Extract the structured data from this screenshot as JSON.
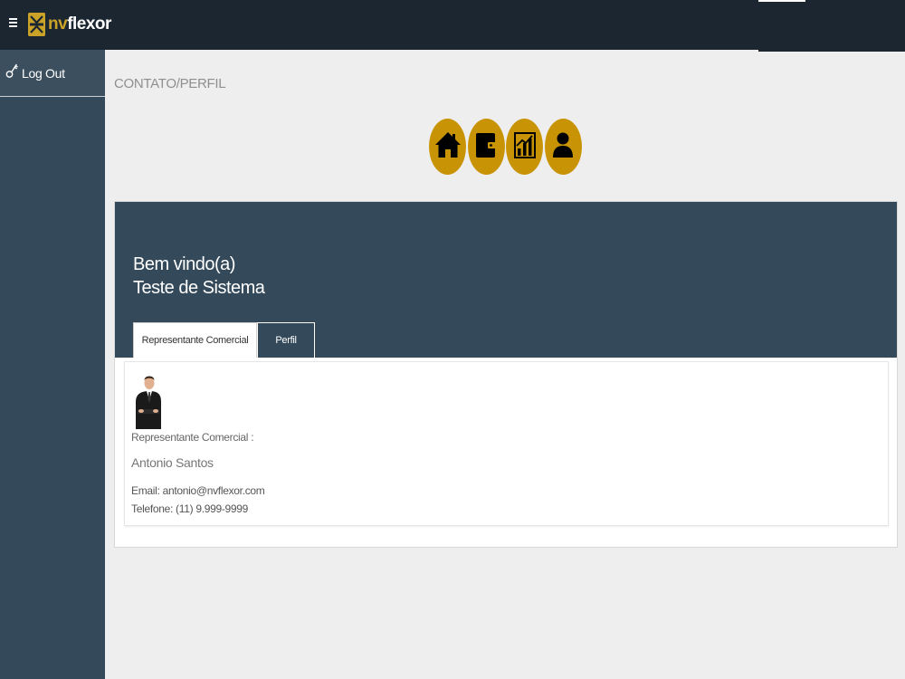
{
  "app": {
    "logo_text_nv": "nv",
    "logo_text_flexor": "flexor",
    "accent_color": "#c89406",
    "dark_color": "#34495a"
  },
  "topbar": {
    "menu_icon": "hamburger-icon"
  },
  "sidebar": {
    "logout_label": "Log Out",
    "logout_icon": "key-icon"
  },
  "breadcrumb": "CONTATO/PERFIL",
  "quick_nav": [
    {
      "icon": "home-icon"
    },
    {
      "icon": "wallet-icon"
    },
    {
      "icon": "chart-icon"
    },
    {
      "icon": "user-icon"
    }
  ],
  "welcome": {
    "line1": "Bem vindo(a)",
    "line2": "Teste de Sistema"
  },
  "tabs": [
    {
      "label": "Representante Comercial",
      "active": true
    },
    {
      "label": "Perfil",
      "active": false
    }
  ],
  "representative": {
    "label": "Representante Comercial :",
    "name": "Antonio Santos",
    "email": "Email: antonio@nvflexor.com",
    "phone": "Telefone: (11) 9.999-9999"
  }
}
